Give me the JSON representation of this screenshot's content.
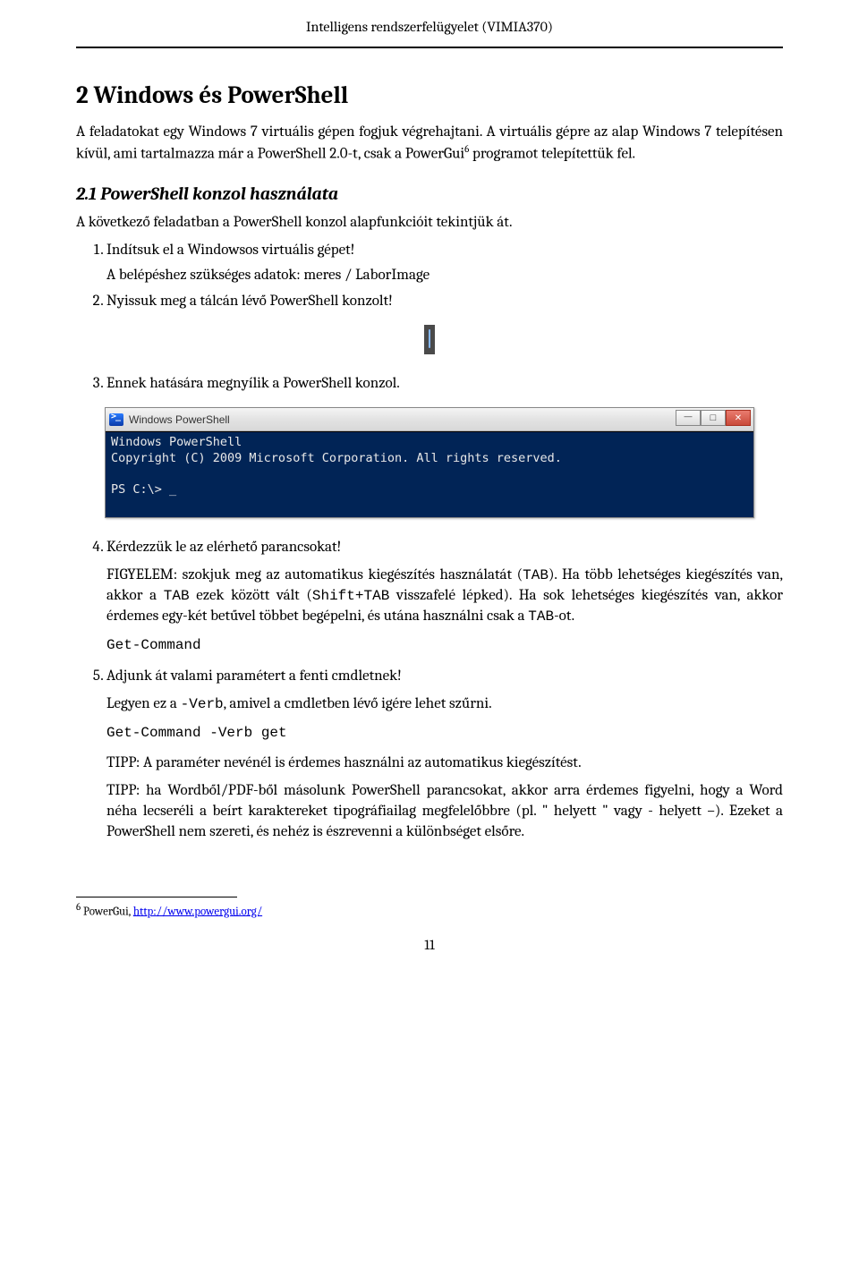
{
  "header": "Intelligens rendszerfelügyelet (VIMIA370)",
  "h1": "2   Windows és PowerShell",
  "intro": {
    "p1_a": "A feladatokat egy Windows 7 virtuális gépen fogjuk végrehajtani. A virtuális gépre az alap Windows 7 telepítésen kívül, ami tartalmazza már a PowerShell 2.0-t, csak a PowerGui",
    "p1_sup": "6",
    "p1_b": " programot telepítettük fel."
  },
  "h2": "2.1   PowerShell konzol használata",
  "p_konzol": "A következő feladatban a PowerShell konzol alapfunkcióit tekintjük át.",
  "li1": "Indítsuk el a Windowsos virtuális gépet!",
  "li1_sub": "A belépéshez szükséges adatok: meres / LaborImage",
  "li2": "Nyissuk meg a tálcán lévő PowerShell konzolt!",
  "li3": "Ennek hatására megnyílik a PowerShell konzol.",
  "ps_window": {
    "title": "Windows PowerShell",
    "line1": "Windows PowerShell",
    "line2": "Copyright (C) 2009 Microsoft Corporation. All rights reserved.",
    "prompt": "PS C:\\> _"
  },
  "li4": "Kérdezzük le az elérhető parancsokat!",
  "li4_note_a": "FIGYELEM: szokjuk meg az automatikus kiegészítés használatát (",
  "li4_note_tab1": "TAB",
  "li4_note_b": "). Ha több lehetséges kiegészítés van, akkor a ",
  "li4_note_tab2": "TAB",
  "li4_note_c": " ezek között vált (",
  "li4_note_shift": "Shift+TAB",
  "li4_note_d": " visszafelé lépked). Ha sok lehetséges kiegészítés van, akkor érdemes egy-két betűvel többet begépelni, és utána használni csak a ",
  "li4_note_tab3": "TAB",
  "li4_note_e": "-ot.",
  "cmd1": "Get-Command",
  "li5": "Adjunk át valami paramétert a fenti cmdletnek!",
  "li5_sub_a": "Legyen ez a ",
  "li5_sub_verb": "-Verb",
  "li5_sub_b": ", amivel a cmdletben lévő igére lehet szűrni.",
  "cmd2": "Get-Command -Verb get",
  "tip1": "TIPP: A paraméter nevénél is érdemes használni az automatikus kiegészítést.",
  "tip2": "TIPP: ha Wordből/PDF-ből másolunk PowerShell parancsokat, akkor arra érdemes figyelni, hogy a Word néha lecseréli a beírt karaktereket tipográfiailag megfelelőbbre (pl. \" helyett \" vagy - helyett –). Ezeket a PowerShell nem szereti, és nehéz is észrevenni a különbséget elsőre.",
  "footnote_num": "6",
  "footnote_text": " PowerGui, ",
  "footnote_url": "http://www.powergui.org/",
  "pagenum": "11"
}
